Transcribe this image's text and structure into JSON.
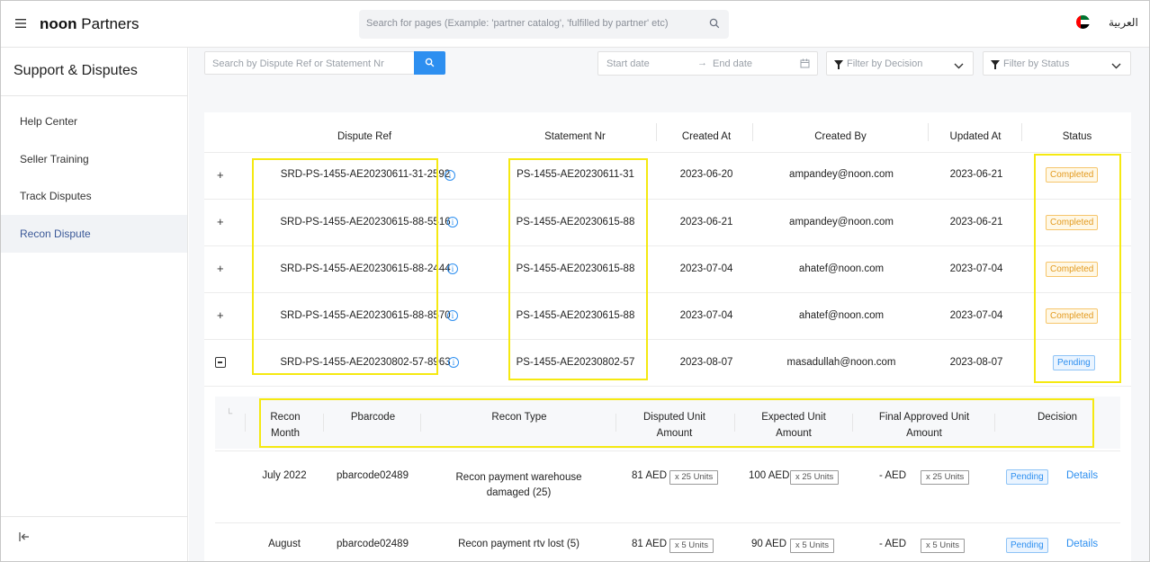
{
  "header": {
    "brand_bold": "noon",
    "brand_rest": " Partners",
    "search_placeholder": "Search for pages (Example: 'partner catalog', 'fulfilled by partner' etc)",
    "language": "العربية"
  },
  "sidebar": {
    "title": "Support & Disputes",
    "items": [
      {
        "label": "Help Center"
      },
      {
        "label": "Seller Training"
      },
      {
        "label": "Track Disputes"
      },
      {
        "label": "Recon Dispute"
      }
    ]
  },
  "filters": {
    "search_placeholder": "Search by Dispute Ref or Statement Nr",
    "start_date": "Start date",
    "end_date": "End date",
    "decision_placeholder": "Filter by Decision",
    "status_placeholder": "Filter by Status"
  },
  "table": {
    "columns": [
      "Dispute Ref",
      "Statement Nr",
      "Created At",
      "Created By",
      "Updated At",
      "Status"
    ],
    "rows": [
      {
        "dispute_ref": "SRD-PS-1455-AE20230611-31-2592",
        "statement_nr": "PS-1455-AE20230611-31",
        "created_at": "2023-06-20",
        "created_by": "ampandey@noon.com",
        "updated_at": "2023-06-21",
        "status": "Completed"
      },
      {
        "dispute_ref": "SRD-PS-1455-AE20230615-88-5516",
        "statement_nr": "PS-1455-AE20230615-88",
        "created_at": "2023-06-21",
        "created_by": "ampandey@noon.com",
        "updated_at": "2023-06-21",
        "status": "Completed"
      },
      {
        "dispute_ref": "SRD-PS-1455-AE20230615-88-2444",
        "statement_nr": "PS-1455-AE20230615-88",
        "created_at": "2023-07-04",
        "created_by": "ahatef@noon.com",
        "updated_at": "2023-07-04",
        "status": "Completed"
      },
      {
        "dispute_ref": "SRD-PS-1455-AE20230615-88-8570",
        "statement_nr": "PS-1455-AE20230615-88",
        "created_at": "2023-07-04",
        "created_by": "ahatef@noon.com",
        "updated_at": "2023-07-04",
        "status": "Completed"
      },
      {
        "dispute_ref": "SRD-PS-1455-AE20230802-57-8963",
        "statement_nr": "PS-1455-AE20230802-57",
        "created_at": "2023-08-07",
        "created_by": "masadullah@noon.com",
        "updated_at": "2023-08-07",
        "status": "Pending"
      }
    ],
    "expand_icon": "+",
    "info_icon": "i"
  },
  "subtable": {
    "columns": {
      "recon_month_1": "Recon",
      "recon_month_2": "Month",
      "pbarcode": "Pbarcode",
      "recon_type": "Recon Type",
      "disputed_1": "Disputed Unit",
      "disputed_2": "Amount",
      "expected_1": "Expected Unit",
      "expected_2": "Amount",
      "final_1": "Final Approved Unit",
      "final_2": "Amount",
      "decision": "Decision"
    },
    "rows": [
      {
        "month": "July 2022",
        "pbarcode": "pbarcode02489",
        "type_1": "Recon payment warehouse",
        "type_2": "damaged (25)",
        "disputed": "81 AED",
        "disputed_units": "x 25 Units",
        "expected": "100 AED",
        "expected_units": "x 25 Units",
        "final": "- AED",
        "final_units": "x 25 Units",
        "decision": "Pending",
        "details": "Details"
      },
      {
        "month": "August",
        "pbarcode": "pbarcode02489",
        "type_1": "Recon payment rtv lost (5)",
        "type_2": "",
        "disputed": "81 AED",
        "disputed_units": "x 5 Units",
        "expected": "90 AED",
        "expected_units": "x 5 Units",
        "final": "- AED",
        "final_units": "x 5 Units",
        "decision": "Pending",
        "details": "Details"
      }
    ]
  },
  "colors": {
    "accent": "#2d8ff0",
    "highlight": "#f5e911",
    "completed": "#e39a1e",
    "pending": "#2d8ff0"
  },
  "icons": {
    "menu": "hamburger-icon",
    "search": "search-icon",
    "flag": "uae-flag-icon",
    "calendar": "calendar-icon",
    "filter": "filter-icon",
    "chevron": "chevron-down-icon",
    "collapse": "collapse-sidebar-icon",
    "expand": "expand-row-icon",
    "collapse_row": "collapse-row-icon",
    "info": "info-icon"
  }
}
